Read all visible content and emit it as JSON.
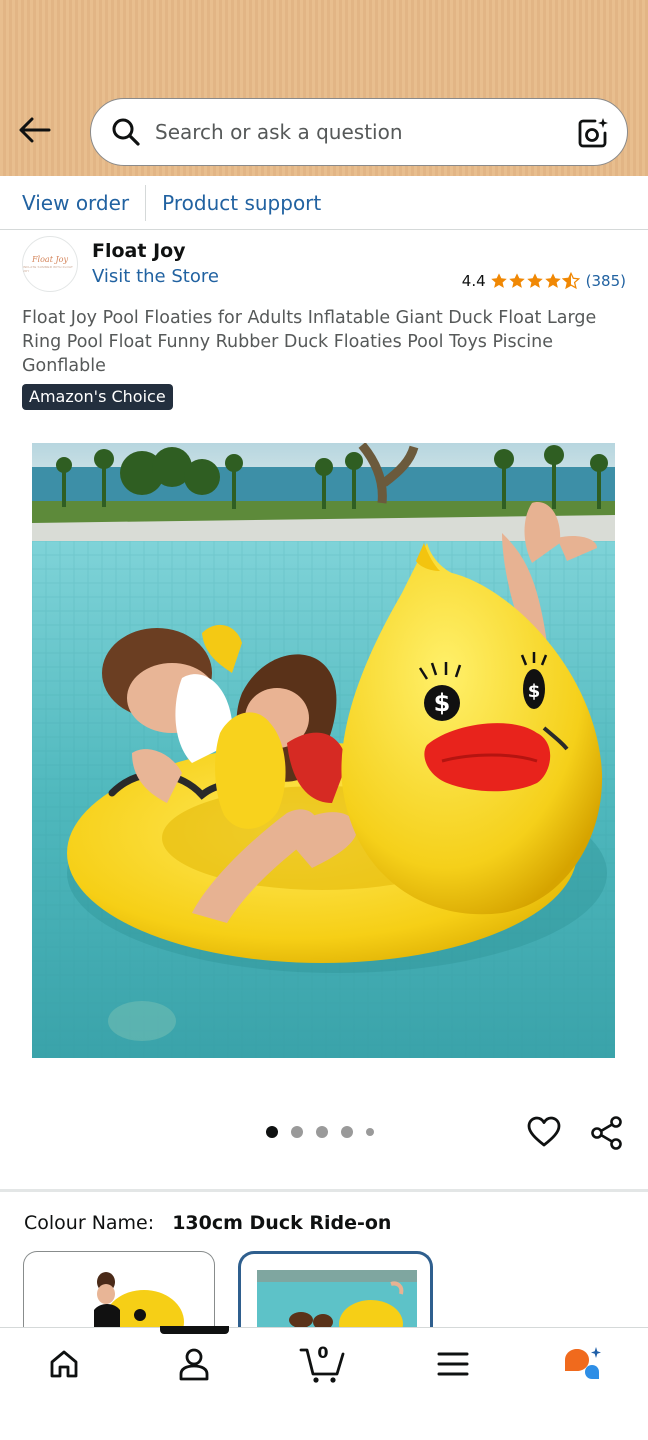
{
  "search": {
    "placeholder": "Search or ask a question"
  },
  "order_links": {
    "view_order": "View order",
    "product_support": "Product support"
  },
  "store": {
    "name": "Float Joy",
    "visit": "Visit the Store",
    "logo_text": "Float Joy",
    "logo_subtext": "INFLATE SUMMER WITH FLOAT JOY"
  },
  "rating": {
    "value": "4.4",
    "stars_filled": 4.4,
    "count": "(385)",
    "star_color": "#f08804"
  },
  "product": {
    "title": "Float Joy Pool Floaties for Adults Inflatable Giant Duck Float Large Ring Pool Float Funny Rubber Duck Floaties Pool Toys Piscine Gonflable",
    "badge": "Amazon's Choice"
  },
  "carousel": {
    "image_count": 5,
    "active_index": 0
  },
  "variant": {
    "label": "Colour Name:",
    "value": "130cm Duck Ride-on",
    "selected_index": 1
  },
  "cart": {
    "count": "0"
  },
  "colors": {
    "link": "#2162a1",
    "header_bg": "#e8be8e",
    "badge_bg": "#232f3e",
    "selected_border": "#2f5f8e",
    "rufus_orange": "#f06a1d",
    "rufus_blue": "#2e8ee6"
  },
  "icons": [
    "back-arrow-icon",
    "search-icon",
    "camera-icon",
    "heart-icon",
    "share-icon",
    "home-icon",
    "account-icon",
    "cart-icon",
    "menu-icon",
    "rufus-icon"
  ]
}
